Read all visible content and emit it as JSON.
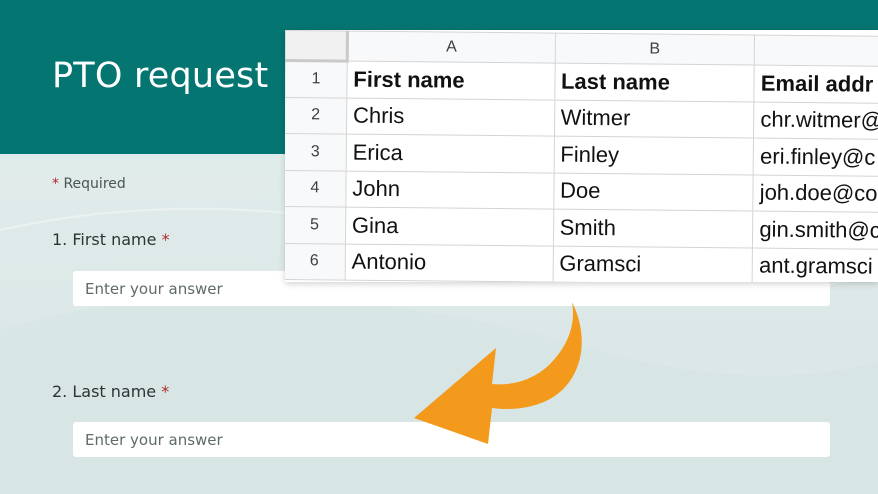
{
  "form": {
    "title": "PTO request",
    "required_marker": "*",
    "required_text": "Required",
    "questions": [
      {
        "label": "1. First name",
        "placeholder": "Enter your answer"
      },
      {
        "label": "2. Last name",
        "placeholder": "Enter your answer"
      }
    ],
    "colors": {
      "header": "#047571",
      "required_star": "#b4262b"
    }
  },
  "spreadsheet": {
    "columns": [
      "A",
      "B",
      ""
    ],
    "rows": [
      {
        "num": "1",
        "cells": [
          "First name",
          "Last name",
          "Email addr"
        ]
      },
      {
        "num": "2",
        "cells": [
          "Chris",
          "Witmer",
          "chr.witmer@"
        ]
      },
      {
        "num": "3",
        "cells": [
          "Erica",
          "Finley",
          "eri.finley@c"
        ]
      },
      {
        "num": "4",
        "cells": [
          "John",
          "Doe",
          "joh.doe@co"
        ]
      },
      {
        "num": "5",
        "cells": [
          "Gina",
          "Smith",
          "gin.smith@c"
        ]
      },
      {
        "num": "6",
        "cells": [
          "Antonio",
          "Gramsci",
          "ant.gramsci"
        ]
      }
    ]
  },
  "arrow": {
    "icon": "curved-arrow-icon",
    "color": "#f39a1c"
  }
}
